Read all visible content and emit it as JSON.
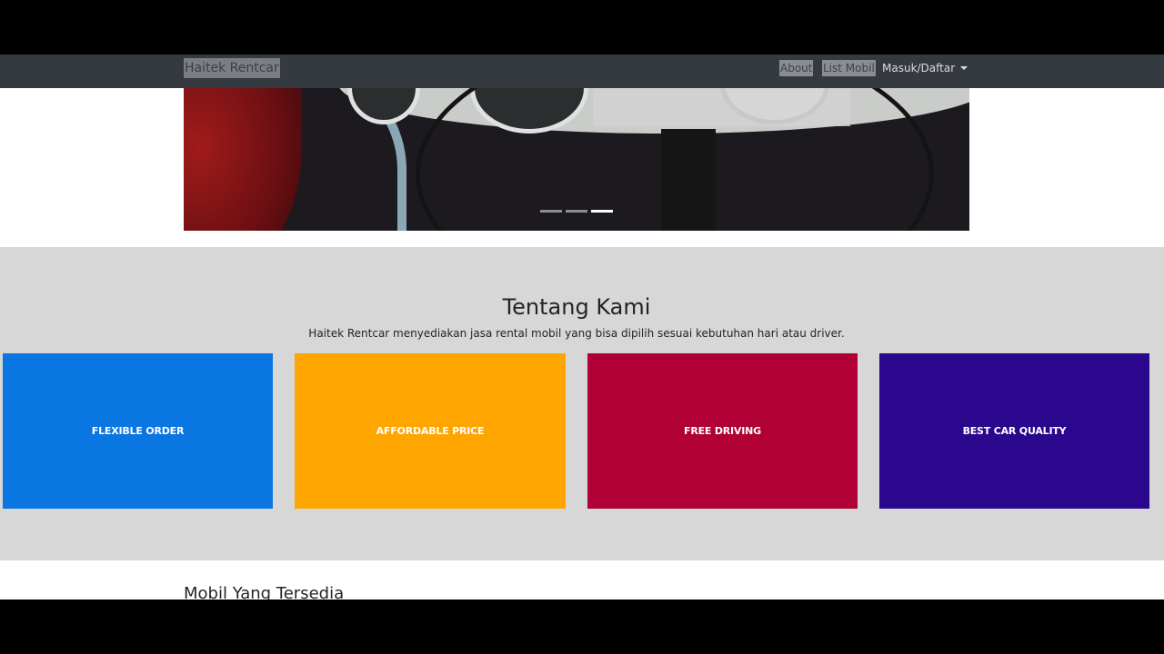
{
  "navbar": {
    "brand": "Haitek Rentcar",
    "links": [
      {
        "label": "About"
      },
      {
        "label": "List Mobil"
      }
    ],
    "dropdown_label": "Masuk/Daftar"
  },
  "carousel": {
    "indicator_count": 3,
    "active_index": 2
  },
  "about": {
    "title": "Tentang Kami",
    "description": "Haitek Rentcar menyediakan jasa rental mobil yang bisa dipilih sesuai kebutuhan hari atau driver.",
    "features": [
      {
        "label": "FLEXIBLE ORDER",
        "color": "#0a76e2"
      },
      {
        "label": "AFFORDABLE PRICE",
        "color": "#ffa500"
      },
      {
        "label": "FREE DRIVING",
        "color": "#b10035"
      },
      {
        "label": "BEST CAR QUALITY",
        "color": "#2a078d"
      }
    ]
  },
  "cars_section": {
    "title": "Mobil Yang Tersedia"
  },
  "colors": {
    "navbar_bg": "#343a40",
    "about_bg": "#d7d7d7",
    "letterbox": "#000000"
  }
}
